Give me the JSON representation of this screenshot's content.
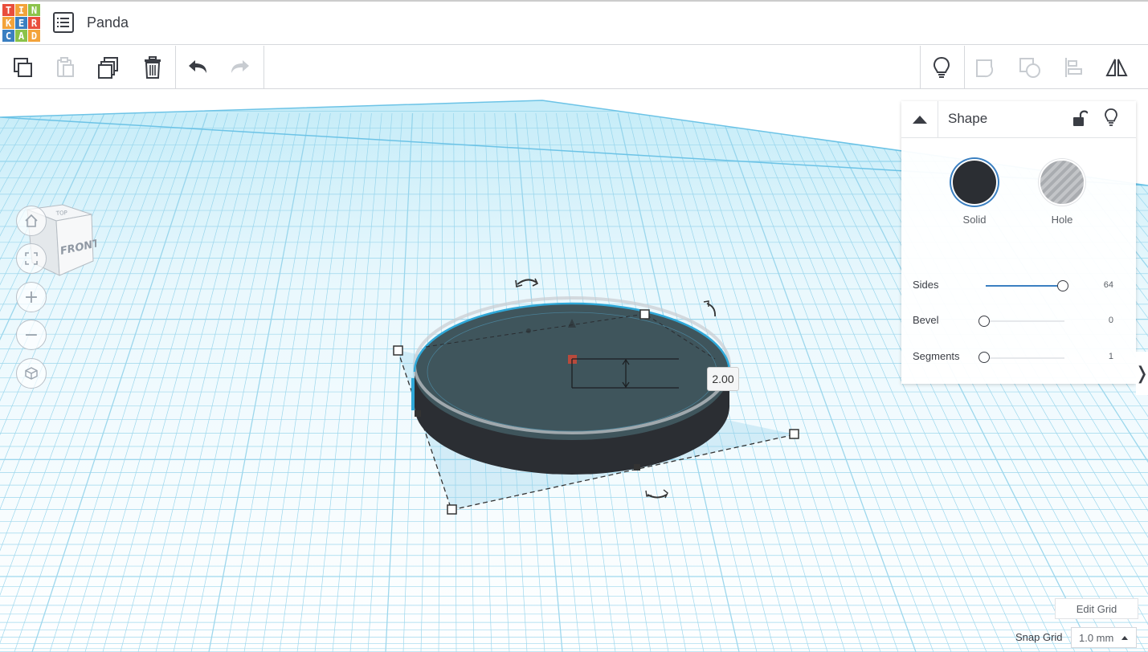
{
  "app": {
    "logo_letters": [
      "T",
      "I",
      "N",
      "K",
      "E",
      "R",
      "C",
      "A",
      "D"
    ],
    "logo_colors": [
      "#e94e3c",
      "#f3a33a",
      "#8bc34a",
      "#f3a33a",
      "#3a7fc1",
      "#e94e3c",
      "#3a7fc1",
      "#8bc34a",
      "#f3a33a"
    ],
    "title": "Panda"
  },
  "toolbar": {
    "left_tools": [
      "copy-icon",
      "paste-icon",
      "duplicate-icon",
      "delete-icon",
      "undo-icon",
      "redo-icon"
    ],
    "right_tools": [
      "lightbulb-icon",
      "group-icon",
      "ungroup-icon",
      "align-icon",
      "mirror-icon"
    ]
  },
  "viewcube": {
    "top_label": "TOP",
    "front_label": "FRONT"
  },
  "nav": {
    "buttons": [
      "home-view-icon",
      "fit-view-icon",
      "zoom-in-icon",
      "zoom-out-icon",
      "perspective-icon"
    ],
    "zoom_in_glyph": "+",
    "zoom_out_glyph": "−"
  },
  "shape_panel": {
    "title": "Shape",
    "materials": [
      {
        "label": "Solid",
        "selected": true,
        "color": "#2b2e33"
      },
      {
        "label": "Hole",
        "selected": false,
        "color": "#c3c5c8"
      }
    ],
    "properties": [
      {
        "label": "Sides",
        "value": "64",
        "fraction": 1.0
      },
      {
        "label": "Bevel",
        "value": "0",
        "fraction": 0.0
      },
      {
        "label": "Segments",
        "value": "1",
        "fraction": 0.0
      }
    ]
  },
  "dimension_label": "2.00",
  "grid_controls": {
    "edit_grid": "Edit Grid",
    "snap_label": "Snap Grid",
    "snap_value": "1.0 mm"
  },
  "colors": {
    "grid_blue": "#8ed1ea",
    "plane_fill": "#e7f6fc",
    "accent": "#3a7fc1",
    "shape_top": "#3d535a",
    "shape_side": "#2b2e33",
    "selection": "#2fa8d8"
  }
}
